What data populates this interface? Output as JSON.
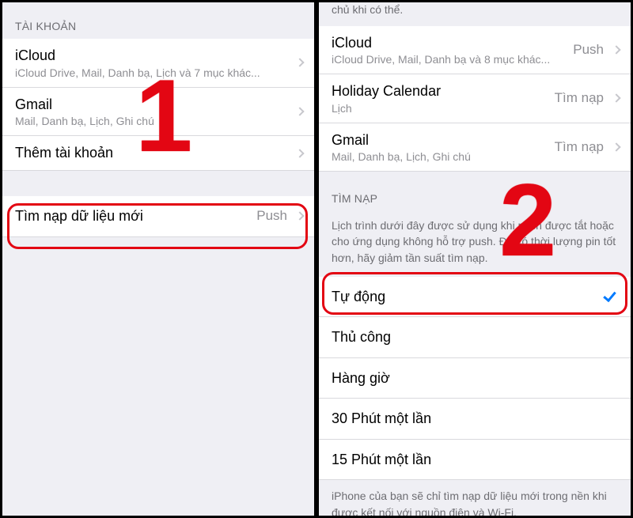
{
  "annotations": {
    "step1": "1",
    "step2": "2"
  },
  "left": {
    "section_header": "TÀI KHOẢN",
    "accounts": [
      {
        "title": "iCloud",
        "sub": "iCloud Drive, Mail, Danh bạ, Lịch và 7 mục khác..."
      },
      {
        "title": "Gmail",
        "sub": "Mail, Danh bạ, Lịch, Ghi chú"
      }
    ],
    "add_account_label": "Thêm tài khoản",
    "fetch_row": {
      "title": "Tìm nạp dữ liệu mới",
      "value": "Push"
    }
  },
  "right": {
    "partial_top": "chủ khi có thể.",
    "accounts": [
      {
        "title": "iCloud",
        "sub": "iCloud Drive, Mail, Danh bạ và 8 mục khác...",
        "value": "Push"
      },
      {
        "title": "Holiday Calendar",
        "sub": "Lịch",
        "value": "Tìm nạp"
      },
      {
        "title": "Gmail",
        "sub": "Mail, Danh bạ, Lịch, Ghi chú",
        "value": "Tìm nạp"
      }
    ],
    "fetch_header": "TÌM NẠP",
    "fetch_note": "Lịch trình dưới đây được sử dụng khi push được tắt hoặc cho ứng dụng không hỗ trợ push. Để có thời lượng pin tốt hơn, hãy giảm tần suất tìm nạp.",
    "schedule": [
      {
        "label": "Tự động",
        "checked": true
      },
      {
        "label": "Thủ công",
        "checked": false
      },
      {
        "label": "Hàng giờ",
        "checked": false
      },
      {
        "label": "30 Phút một lần",
        "checked": false
      },
      {
        "label": "15 Phút một lần",
        "checked": false
      }
    ],
    "footer_note": "iPhone của bạn sẽ chỉ tìm nạp dữ liệu mới trong nền khi được kết nối với nguồn điện và Wi-Fi."
  }
}
